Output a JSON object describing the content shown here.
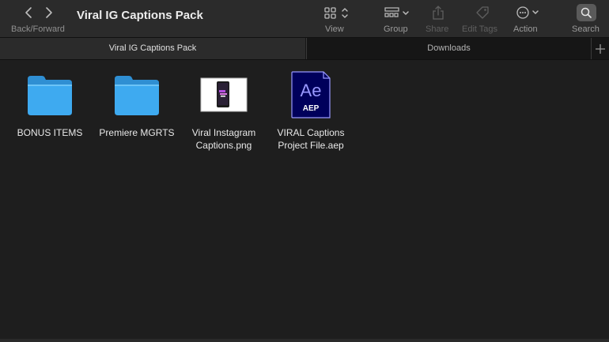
{
  "window": {
    "title": "Viral IG Captions Pack"
  },
  "toolbar": {
    "nav_label": "Back/Forward",
    "view_label": "View",
    "group_label": "Group",
    "share_label": "Share",
    "edit_tags_label": "Edit Tags",
    "action_label": "Action",
    "search_label": "Search"
  },
  "tabs": [
    {
      "label": "Viral IG Captions Pack"
    },
    {
      "label": "Downloads"
    }
  ],
  "files": [
    {
      "name": "BONUS ITEMS",
      "icon": "folder-icon"
    },
    {
      "name": "Premiere MGRTS",
      "icon": "folder-icon"
    },
    {
      "name": "Viral  Instagram\nCaptions.png",
      "icon": "png-thumbnail"
    },
    {
      "name": "VIRAL Captions\nProject File.aep",
      "icon": "after-effects-icon",
      "badge_text": "Ae",
      "badge_ext": "AEP"
    }
  ],
  "colors": {
    "folder": "#3eaaf0",
    "ae_bg": "#00005b",
    "ae_accent": "#9999ff"
  }
}
